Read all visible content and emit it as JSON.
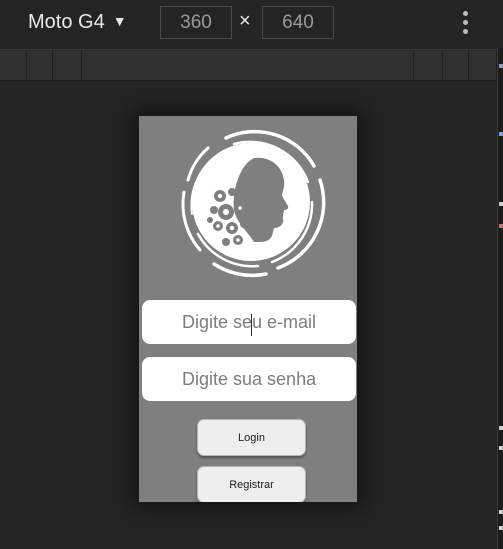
{
  "toolbar": {
    "device_name": "Moto G4",
    "caret_icon": "caret-down-icon",
    "width_value": "360",
    "times_symbol": "×",
    "height_value": "640",
    "more_icon": "kebab-menu-icon"
  },
  "app": {
    "logo_icon": "head-with-gears-logo",
    "email_placeholder": "Digite seu e-mail",
    "password_placeholder": "Digite sua senha",
    "login_label": "Login",
    "register_label": "Registrar"
  },
  "colors": {
    "devtools_bg": "#242424",
    "viewport_bg": "#7f7f7f",
    "field_bg": "#ffffff",
    "button_bg": "#eeeeee"
  }
}
